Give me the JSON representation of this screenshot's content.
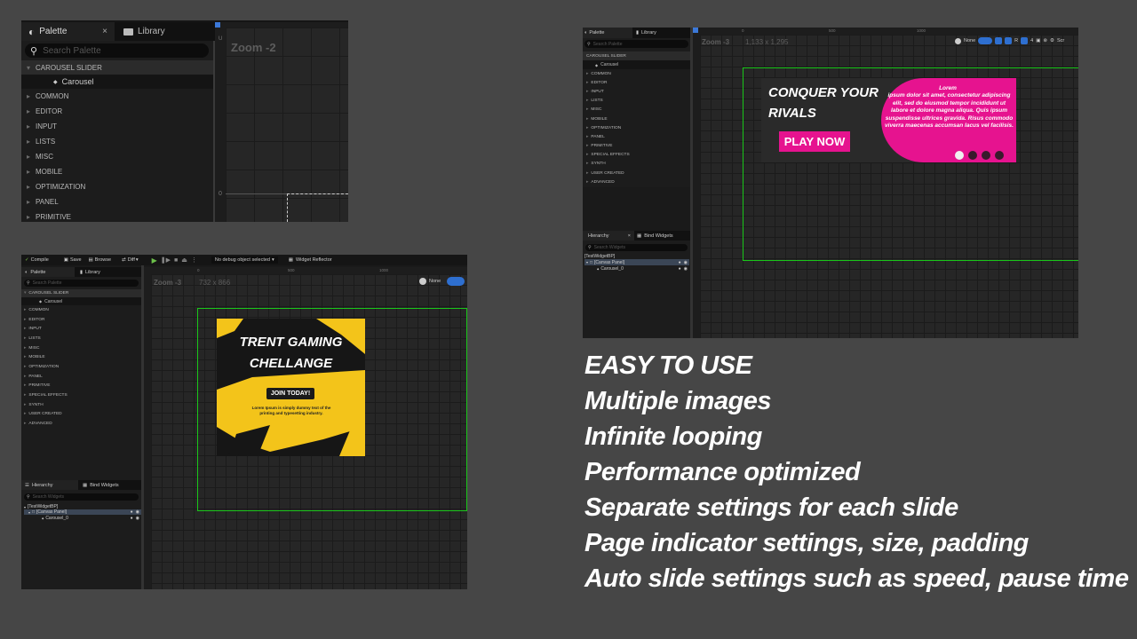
{
  "shot1": {
    "tabs": [
      {
        "label": "Palette",
        "icon": "palette-icon",
        "active": true
      },
      {
        "label": "Library",
        "icon": "folder-icon",
        "active": false
      }
    ],
    "close_glyph": "×",
    "search_placeholder": "Search Palette",
    "section": "CAROUSEL SLIDER",
    "sub_item": "Carousel",
    "categories": [
      "COMMON",
      "EDITOR",
      "INPUT",
      "LISTS",
      "MISC",
      "MOBILE",
      "OPTIMIZATION",
      "PANEL",
      "PRIMITIVE"
    ],
    "zoom": "Zoom -2",
    "ruler_left_u": "U",
    "ruler_left_zero": "0"
  },
  "shot2": {
    "toolbar": {
      "compile": "Compile",
      "save": "Save",
      "browse": "Browse",
      "diff": "Diff",
      "debug_select": "No debug object selected",
      "reflector": "Widget Reflector"
    },
    "tabs": [
      {
        "label": "Palette"
      },
      {
        "label": "Library"
      }
    ],
    "search_placeholder": "Search Palette",
    "section": "CAROUSEL SLIDER",
    "sub_item": "Carousel",
    "categories": [
      "COMMON",
      "EDITOR",
      "INPUT",
      "LISTS",
      "MISC",
      "MOBILE",
      "OPTIMIZATION",
      "PANEL",
      "PRIMITIVE",
      "SPECIAL EFFECTS",
      "SYNTH",
      "USER CREATED",
      "ADVANCED"
    ],
    "ruler_ticks": [
      "0",
      "500",
      "1000"
    ],
    "zoom": "Zoom -3",
    "size": "732 x 866",
    "none_label": "None",
    "hierarchy_tabs": [
      "Hierarchy",
      "Bind Widgets"
    ],
    "hierarchy_search": "Search Widgets",
    "tree": [
      "[TestWidgetBP]",
      "[Canvas Panel]",
      "Carousel_0"
    ],
    "banner": {
      "title_line1": "TRENT GAMING",
      "title_line2": "CHELLANGE",
      "button": "JOIN TODAY!",
      "body": "Lorem Ipsum is simply dummy text of the printing and typesetting industry.",
      "bg": "#f3c41a"
    }
  },
  "shot3": {
    "tabs": [
      {
        "label": "Palette"
      },
      {
        "label": "Library"
      }
    ],
    "search_placeholder": "Search Palette",
    "section": "CAROUSEL SLIDER",
    "sub_item": "Carousel",
    "categories": [
      "COMMON",
      "EDITOR",
      "INPUT",
      "LISTS",
      "MISC",
      "MOBILE",
      "OPTIMIZATION",
      "PANEL",
      "PRIMITIVE",
      "SPECIAL EFFECTS",
      "SYNTH",
      "USER CREATED",
      "ADVANCED"
    ],
    "ruler_ticks": [
      "0",
      "500",
      "1000"
    ],
    "zoom": "Zoom -3",
    "size": "1,133 x 1,295",
    "none_label": "None",
    "r_label": "R",
    "num_label": "4",
    "scr_label": "Scr",
    "hierarchy_tabs": [
      "Hierarchy",
      "Bind Widgets"
    ],
    "hierarchy_search": "Search Widgets",
    "tree": [
      "[TestWidgetBP]",
      "[Canvas Panel]",
      "Carousel_0"
    ],
    "banner": {
      "title_line1": "CONQUER YOUR",
      "title_line2": "RIVALS",
      "button": "PLAY NOW",
      "lorem_title": "Lorem",
      "lorem_body": "ipsum dolor sit amet, consectetur adipiscing elit, sed do eiusmod tempor incididunt ut labore et dolore magna aliqua. Quis ipsum suspendisse ultrices gravida. Risus commodo viverra maecenas accumsan lacus vel facilisis.",
      "accent": "#e6138f",
      "page_count": 4,
      "active_page": 1
    }
  },
  "features": [
    "EASY TO USE",
    "Multiple images",
    "Infinite looping",
    "Performance optimized",
    "Separate settings for each slide",
    "Page indicator settings, size, padding",
    "Auto slide settings such as speed, pause time"
  ]
}
